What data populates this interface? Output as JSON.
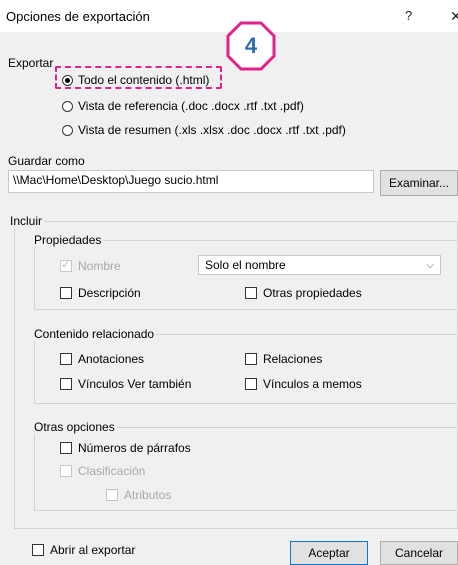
{
  "window": {
    "title": "Opciones de exportación",
    "help": "?",
    "close": "X"
  },
  "step_badge": {
    "number": "4",
    "color": "#e0228a"
  },
  "exportar": {
    "label": "Exportar",
    "options": [
      {
        "label": "Todo el contenido (.html)",
        "checked": true
      },
      {
        "label": "Vista de referencia (.doc .docx .rtf .txt .pdf)",
        "checked": false
      },
      {
        "label": "Vista de resumen (.xls .xlsx .doc .docx .rtf .txt .pdf)",
        "checked": false
      }
    ]
  },
  "guardar": {
    "label": "Guardar como",
    "path": "\\\\Mac\\Home\\Desktop\\Juego sucio.html",
    "browse_label": "Examinar..."
  },
  "incluir": {
    "label": "Incluir",
    "propiedades": {
      "label": "Propiedades",
      "nombre": "Nombre",
      "nombre_select": "Solo el nombre",
      "descripcion": "Descripción",
      "otras": "Otras propiedades"
    },
    "contenido": {
      "label": "Contenido relacionado",
      "anotaciones": "Anotaciones",
      "relaciones": "Relaciones",
      "vinculos_ver": "Vínculos Ver también",
      "vinculos_memos": "Vínculos a memos"
    },
    "otras_opciones": {
      "label": "Otras opciones",
      "numeros": "Números de párrafos",
      "clasificacion": "Clasificación",
      "atributos": "Atributos"
    }
  },
  "footer": {
    "abrir": "Abrir al exportar",
    "aceptar": "Aceptar",
    "cancelar": "Cancelar"
  }
}
